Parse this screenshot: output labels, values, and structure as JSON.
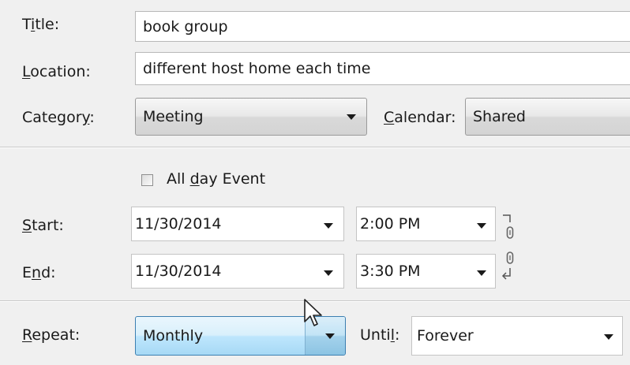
{
  "fields": {
    "title": {
      "label_pre": "T",
      "label_key": "i",
      "label_post": "tle:",
      "value": "book group"
    },
    "location": {
      "label_pre": "",
      "label_key": "L",
      "label_post": "ocation:",
      "value": "different host home each time"
    },
    "category": {
      "label_pre": "Categor",
      "label_key": "y",
      "label_post": ":",
      "value": "Meeting"
    },
    "calendar": {
      "label_pre": "",
      "label_key": "C",
      "label_post": "alendar:",
      "value": "Shared"
    }
  },
  "all_day": {
    "label_pre": "All ",
    "label_key": "d",
    "label_post": "ay Event",
    "checked": false
  },
  "start": {
    "label_pre": "",
    "label_key": "S",
    "label_post": "tart:",
    "date": "11/30/2014",
    "time": "2:00 PM"
  },
  "end": {
    "label_pre": "E",
    "label_key": "n",
    "label_post": "d:",
    "date": "11/30/2014",
    "time": "3:30 PM"
  },
  "repeat": {
    "label_pre": "",
    "label_key": "R",
    "label_post": "epeat:",
    "value": "Monthly"
  },
  "until": {
    "label_pre": "Unti",
    "label_key": "l",
    "label_post": ":",
    "value": "Forever"
  }
}
